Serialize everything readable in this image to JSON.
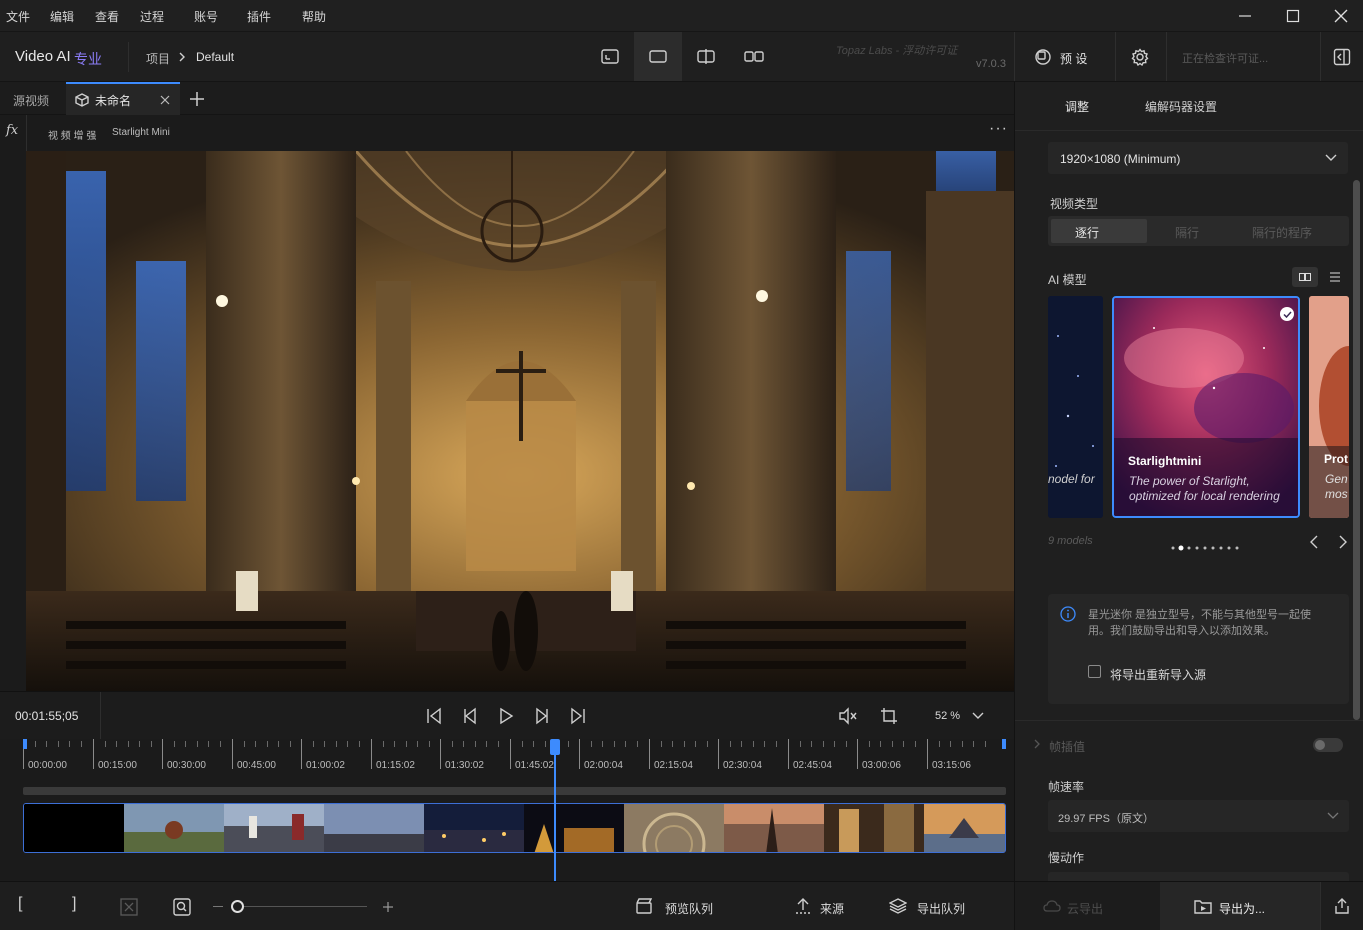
{
  "menubar": {
    "items": [
      "文件",
      "编辑",
      "查看",
      "过程",
      "账号",
      "插件",
      "帮助"
    ]
  },
  "header": {
    "app_name": "Video AI",
    "app_edition": "专业",
    "breadcrumb_root": "项目",
    "breadcrumb_current": "Default",
    "watermark": "Topaz Labs - 浮动许可证",
    "version": "v7.0.3",
    "preset_label": "预 设",
    "license_status": "正在检查许可证..."
  },
  "tabs": {
    "source_label": "源视频",
    "current_label": "未命名"
  },
  "filterbar": {
    "fx_label": "fx",
    "chain_label": "视 频 增 强",
    "model_label": "Starlight Mini"
  },
  "transport": {
    "timecode": "00:01:55;05",
    "zoom": "52 %"
  },
  "timeline": {
    "labels": [
      "00:00:00",
      "00:15:00",
      "00:30:00",
      "00:45:00",
      "01:00:02",
      "01:15:02",
      "01:30:02",
      "01:45:02",
      "02:00:04",
      "02:15:04",
      "02:30:04",
      "02:45:04",
      "03:00:06",
      "03:15:06"
    ],
    "playhead_fraction": 0.54
  },
  "bottombar": {
    "preview_queue": "预览队列",
    "source": "来源",
    "export_queue": "导出队列"
  },
  "panel": {
    "tab_adjust": "调整",
    "tab_codec": "编解码器设置",
    "resolution_value": "1920×1080 (Minimum)",
    "video_type_label": "视频类型",
    "video_type_options": [
      "逐行",
      "隔行",
      "隔行的程序"
    ],
    "ai_model_label": "AI 模型",
    "model_left_desc": "nodel for",
    "model_main_title": "Starlightmini",
    "model_main_desc_1": "The power of Starlight,",
    "model_main_desc_2": "optimized for local rendering",
    "model_right_title": "Prot",
    "model_right_desc_1": "Gen",
    "model_right_desc_2": "mos",
    "models_count": "9 models",
    "info_text_1": "星光迷你 是独立型号，不能与其他型号一起使",
    "info_text_2": "用。我们鼓励导出和导入以添加效果。",
    "reimport_label": "将导出重新导入源",
    "frame_interp_label": "帧插值",
    "frame_rate_label": "帧速率",
    "frame_rate_value": "29.97 FPS（原文）",
    "slow_motion_label": "慢动作",
    "cloud_export": "云导出",
    "export_as": "导出为..."
  },
  "colors": {
    "accent": "#3d8bfd",
    "brand_purple": "#8b7cf6"
  }
}
